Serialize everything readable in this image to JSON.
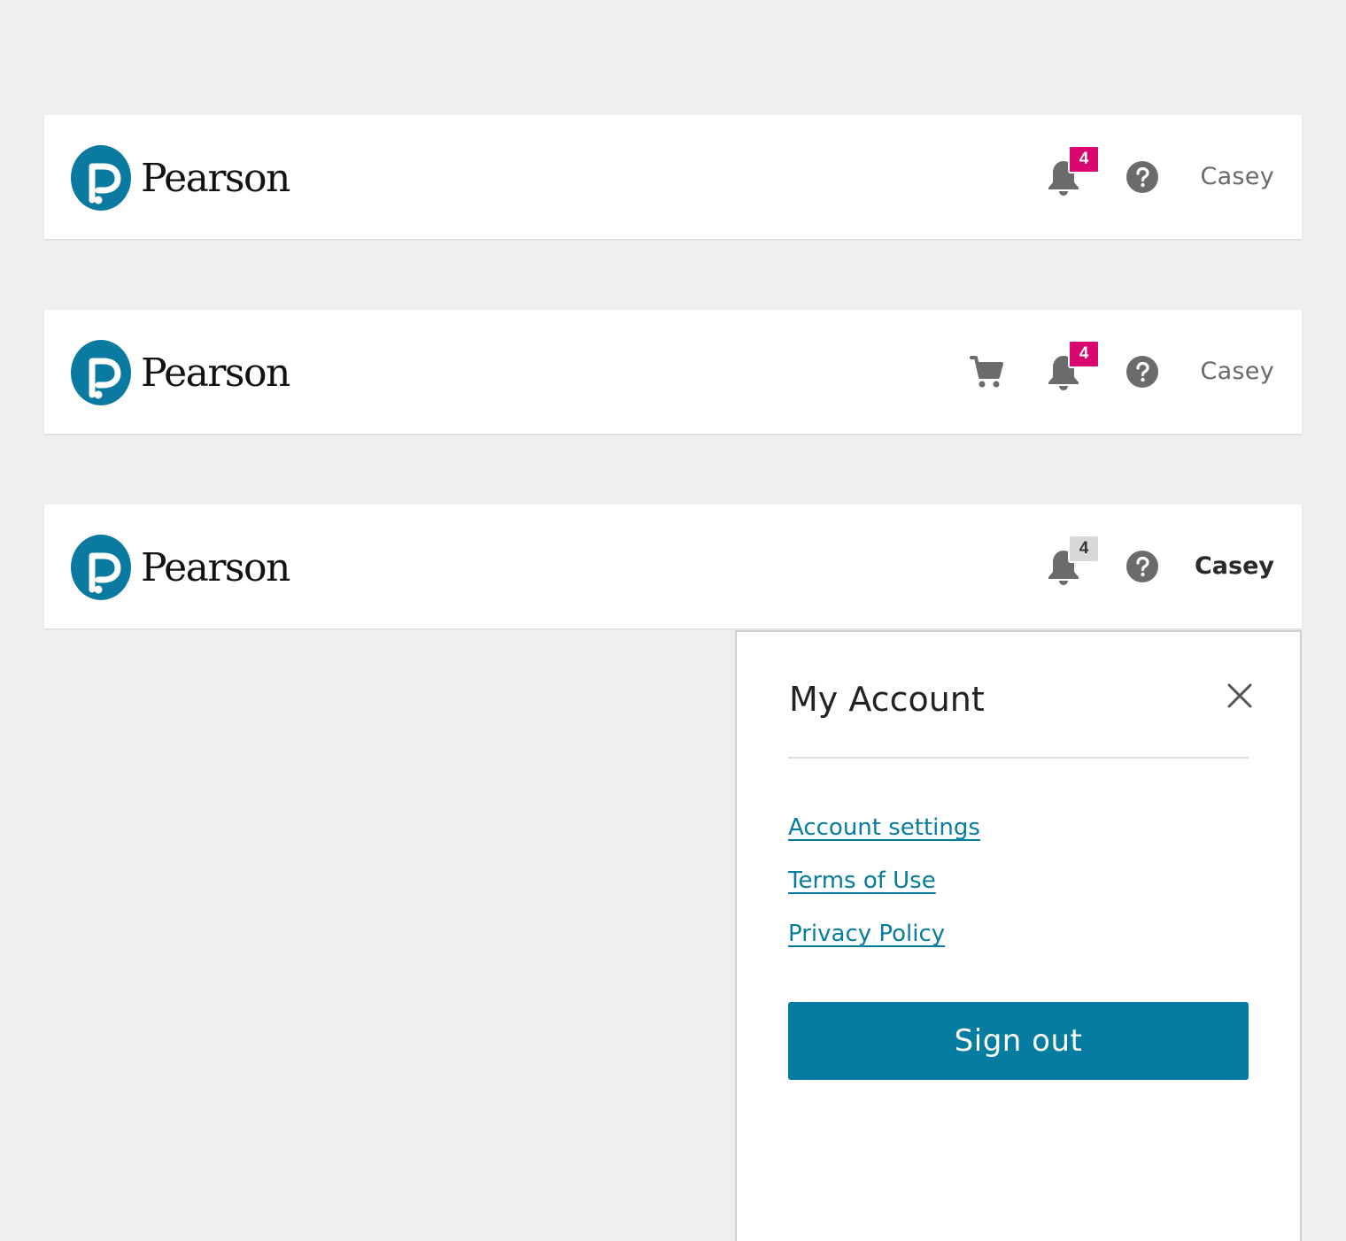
{
  "brand": {
    "name": "Pearson",
    "logo_color": "#0a7aa1"
  },
  "colors": {
    "icon": "#6b6b6b",
    "badge_alert": "#d9066f",
    "badge_muted": "#d8d8d8",
    "link": "#067ca0",
    "primary_button": "#067ca0"
  },
  "headers": [
    {
      "icons": [
        "bell-icon",
        "help-icon"
      ],
      "notification_count": "4",
      "badge_style": "alert",
      "user_name": "Casey",
      "user_menu_open": false
    },
    {
      "icons": [
        "cart-icon",
        "bell-icon",
        "help-icon"
      ],
      "notification_count": "4",
      "badge_style": "alert",
      "user_name": "Casey",
      "user_menu_open": false
    },
    {
      "icons": [
        "bell-icon",
        "help-icon"
      ],
      "notification_count": "4",
      "badge_style": "muted",
      "user_name": "Casey",
      "user_menu_open": true
    }
  ],
  "account_menu": {
    "title": "My Account",
    "close_icon": "close-icon",
    "links": [
      {
        "label": "Account settings"
      },
      {
        "label": "Terms of Use"
      },
      {
        "label": "Privacy Policy"
      }
    ],
    "sign_out_label": "Sign out"
  }
}
